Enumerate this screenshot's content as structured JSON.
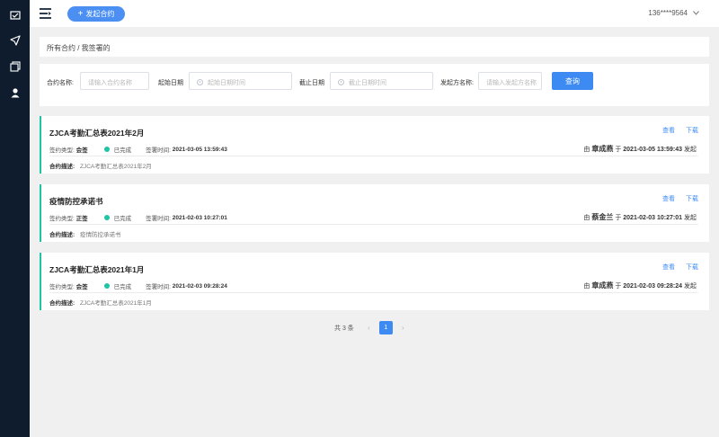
{
  "sidebar": {
    "items": [
      {
        "icon": "contract-icon"
      },
      {
        "icon": "send-icon"
      },
      {
        "icon": "files-icon"
      },
      {
        "icon": "user-icon"
      }
    ]
  },
  "header": {
    "create_button": "发起合约",
    "user": "136****9564"
  },
  "breadcrumb": "所有合约 / 我签署的",
  "filter": {
    "name_label": "合约名称:",
    "name_placeholder": "请输入合约名称",
    "start_label": "起始日期",
    "start_placeholder": "起始日期时间",
    "end_label": "截止日期",
    "end_placeholder": "截止日期时间",
    "sender_label": "发起方名称:",
    "sender_placeholder": "请输入发起方名称",
    "query_button": "查询"
  },
  "contracts": [
    {
      "title": "ZJCA考勤汇总表2021年2月",
      "view": "查看",
      "download": "下载",
      "type_label": "签约类型:",
      "type": "会签",
      "status": "已完成",
      "time_label": "签署时间:",
      "time": "2021-03-05 13:59:43",
      "by_prefix": "由",
      "initiator": "章成燕",
      "at": "于",
      "initiated_time": "2021-03-05 13:59:43",
      "suffix": "发起",
      "desc_label": "合约描述:",
      "desc": "ZJCA考勤汇总表2021年2月"
    },
    {
      "title": "疫情防控承诺书",
      "view": "查看",
      "download": "下载",
      "type_label": "签约类型:",
      "type": "正签",
      "status": "已完成",
      "time_label": "签署时间:",
      "time": "2021-02-03 10:27:01",
      "by_prefix": "由",
      "initiator": "蔡金兰",
      "at": "于",
      "initiated_time": "2021-02-03 10:27:01",
      "suffix": "发起",
      "desc_label": "合约描述:",
      "desc": "疫情防控承诺书"
    },
    {
      "title": "ZJCA考勤汇总表2021年1月",
      "view": "查看",
      "download": "下载",
      "type_label": "签约类型:",
      "type": "会签",
      "status": "已完成",
      "time_label": "签署时间:",
      "time": "2021-02-03 09:28:24",
      "by_prefix": "由",
      "initiator": "章成燕",
      "at": "于",
      "initiated_time": "2021-02-03 09:28:24",
      "suffix": "发起",
      "desc_label": "合约描述:",
      "desc": "ZJCA考勤汇总表2021年1月"
    }
  ],
  "pagination": {
    "total": "共 3 条",
    "prev": "‹",
    "current": "1",
    "next": "›"
  },
  "colors": {
    "sidebar": "#0f1c2e",
    "accent": "#3d8bf2",
    "status": "#1ec4a4"
  }
}
